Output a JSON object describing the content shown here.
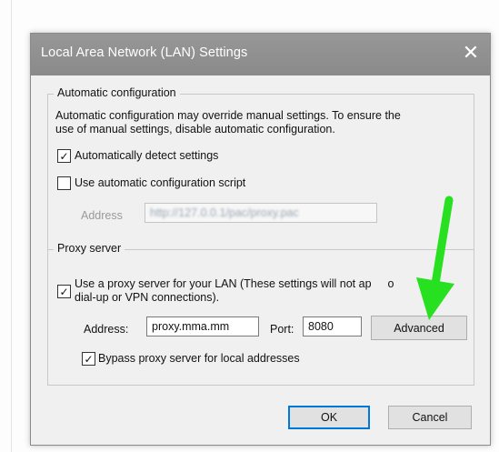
{
  "dialog": {
    "title": "Local Area Network (LAN) Settings",
    "close_icon": "✕"
  },
  "auto_config": {
    "legend": "Automatic configuration",
    "description_line1": "Automatic configuration may override manual settings.  To ensure the",
    "description_line2": "use of manual settings, disable automatic configuration.",
    "detect_label": "Automatically detect settings",
    "detect_checked": true,
    "script_label": "Use automatic configuration script",
    "script_checked": false,
    "address_label": "Address",
    "address_value": "http://127.0.0.1/pac/proxy.pac"
  },
  "proxy": {
    "legend": "Proxy server",
    "use_proxy_label_line1": "Use a proxy server for your LAN (These settings will not ap",
    "use_proxy_label_line1_tail": "o",
    "use_proxy_label_line2": "dial-up or VPN connections).",
    "use_proxy_checked": true,
    "address_label": "Address:",
    "address_value": "proxy.mma.mm",
    "port_label": "Port:",
    "port_value": "8080",
    "advanced_label": "Advanced",
    "bypass_label": "Bypass proxy server for local addresses",
    "bypass_checked": true
  },
  "buttons": {
    "ok": "OK",
    "cancel": "Cancel"
  },
  "annotation": {
    "arrow_color": "#27e01f"
  },
  "icons": {
    "check": "✓"
  }
}
